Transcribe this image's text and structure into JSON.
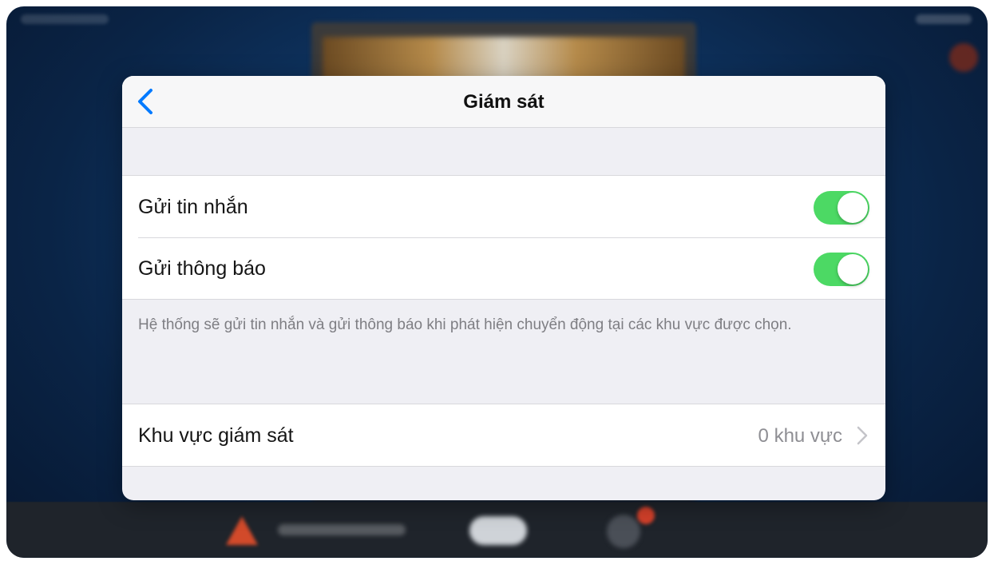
{
  "nav": {
    "title": "Giám sát",
    "back_icon": "chevron-left-icon"
  },
  "notifications": {
    "items": [
      {
        "label": "Gửi tin nhắn",
        "enabled": true
      },
      {
        "label": "Gửi thông báo",
        "enabled": true
      }
    ],
    "footer": "Hệ thống sẽ gửi tin nhắn và gửi thông báo khi phát hiện chuyển động tại các khu vực được chọn."
  },
  "zones": {
    "label": "Khu vực giám sát",
    "value": "0 khu vực",
    "chevron_icon": "chevron-right-icon"
  },
  "colors": {
    "accent": "#007aff",
    "toggle_on": "#4cd964",
    "background": "#efeff4"
  }
}
